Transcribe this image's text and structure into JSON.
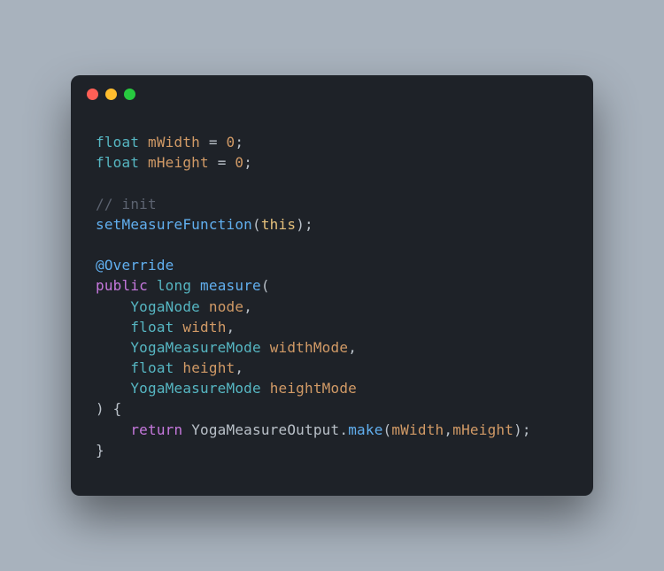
{
  "traffic_lights": [
    "red",
    "yellow",
    "green"
  ],
  "code": {
    "l1": {
      "t1": "float",
      "v1": "mWidth",
      "eq": " = ",
      "n1": "0",
      "end": ";"
    },
    "l2": {
      "t1": "float",
      "v1": "mHeight",
      "eq": " = ",
      "n1": "0",
      "end": ";"
    },
    "l3": {
      "comment": "// init"
    },
    "l4": {
      "fn": "setMeasureFunction",
      "open": "(",
      "this": "this",
      "close": ");"
    },
    "l5": {
      "annot": "@Override"
    },
    "l6": {
      "mod": "public",
      "sp": " ",
      "type": "long",
      "fn": "measure",
      "open": "("
    },
    "l7": {
      "indent": "    ",
      "type": "YogaNode",
      "var": "node",
      "end": ","
    },
    "l8": {
      "indent": "    ",
      "type": "float",
      "var": "width",
      "end": ","
    },
    "l9": {
      "indent": "    ",
      "type": "YogaMeasureMode",
      "var": "widthMode",
      "end": ","
    },
    "l10": {
      "indent": "    ",
      "type": "float",
      "var": "height",
      "end": ","
    },
    "l11": {
      "indent": "    ",
      "type": "YogaMeasureMode",
      "var": "heightMode"
    },
    "l12": {
      "text": ") {"
    },
    "l13": {
      "indent": "    ",
      "ret": "return",
      "cls": "YogaMeasureOutput",
      "dot": ".",
      "fn": "make",
      "open": "(",
      "a1": "mWidth",
      "comma": ",",
      "a2": "mHeight",
      "close": ");"
    },
    "l14": {
      "text": "}"
    }
  }
}
